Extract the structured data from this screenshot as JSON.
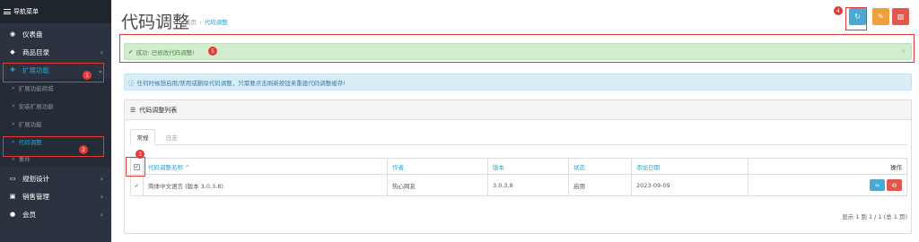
{
  "sidebar": {
    "header": "导航菜单",
    "items": [
      {
        "label": "仪表盘",
        "icon": "dashboard-icon"
      },
      {
        "label": "商品目录",
        "icon": "tag-icon"
      },
      {
        "label": "扩展功能",
        "icon": "puzzle-icon"
      },
      {
        "label": "规划设计",
        "icon": "desktop-icon"
      },
      {
        "label": "销售管理",
        "icon": "cart-icon"
      },
      {
        "label": "会员",
        "icon": "user-icon"
      }
    ],
    "sub_items": [
      {
        "label": "扩展功能商城"
      },
      {
        "label": "安装扩展功能"
      },
      {
        "label": "扩展功能"
      },
      {
        "label": "代码调整"
      },
      {
        "label": "事件"
      }
    ]
  },
  "header": {
    "title": "代码调整",
    "breadcrumb": [
      "首页",
      "代码调整"
    ]
  },
  "alerts": {
    "success": "成功: 已修改代码调整!",
    "success_close": "×",
    "info": "任何时候想启用/禁用或删除代码调整，只需要点击刷新按钮来重建代码调整缓存!"
  },
  "panel": {
    "title": "代码调整列表",
    "tabs": [
      {
        "label": "常规"
      },
      {
        "label": "日志"
      }
    ],
    "columns": [
      "代码调整名称 ^",
      "作者",
      "版本",
      "状态",
      "添加日期",
      "操作"
    ],
    "rows": [
      {
        "name": "简体中文语言 (版本 3.0.3.8)",
        "author": "热心网友",
        "version": "3.0.3.8",
        "status": "启用",
        "date": "2023-09-09"
      }
    ],
    "pager": "显示 1 到 1 / 1 (总 1 页)"
  },
  "annotations": [
    "1",
    "2",
    "3",
    "4",
    "5"
  ],
  "colors": {
    "accent": "#2ea2cc",
    "sidebar_bg": "#2b3340",
    "success_bg": "#d3ecd0",
    "info_bg": "#d9edf7",
    "annotation_red": "#e53935"
  }
}
